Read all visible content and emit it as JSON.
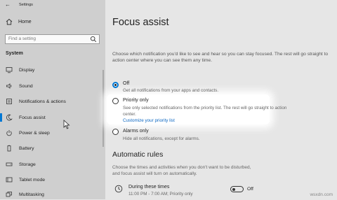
{
  "window": {
    "title": "Settings"
  },
  "sidebar": {
    "home_label": "Home",
    "search_placeholder": "Find a setting",
    "section_heading": "System",
    "items": [
      {
        "label": "Display",
        "icon": "monitor-icon"
      },
      {
        "label": "Sound",
        "icon": "speaker-icon"
      },
      {
        "label": "Notifications & actions",
        "icon": "notification-icon"
      },
      {
        "label": "Focus assist",
        "icon": "moon-icon",
        "selected": true
      },
      {
        "label": "Power & sleep",
        "icon": "power-icon"
      },
      {
        "label": "Battery",
        "icon": "battery-icon"
      },
      {
        "label": "Storage",
        "icon": "storage-icon"
      },
      {
        "label": "Tablet mode",
        "icon": "tablet-icon"
      },
      {
        "label": "Multitasking",
        "icon": "multitasking-icon"
      }
    ]
  },
  "main": {
    "title": "Focus assist",
    "description": "Choose which notification you'd like to see and hear so you can stay focused. The rest will go straight to action center where you can see them any time.",
    "options": [
      {
        "label": "Off",
        "sub": "Get all notifications from your apps and contacts.",
        "selected": true
      },
      {
        "label": "Priority only",
        "sub": "See only selected notifications from the priority list. The rest will go straight to action center.",
        "link": "Customize your priority list",
        "selected": false
      },
      {
        "label": "Alarms only",
        "sub": "Hide all notifications, except for alarms.",
        "selected": false
      }
    ],
    "rules_heading": "Automatic rules",
    "rules_description": "Choose the times and activities when you don't want to be disturbed, and focus assist will turn on automatically.",
    "rule": {
      "label": "During these times",
      "sub": "11:00 PM - 7:00 AM; Priority only",
      "toggle_label": "Off",
      "toggle_on": false
    }
  },
  "watermark": "wsxdn.com",
  "colors": {
    "accent": "#0078d4",
    "link": "#0a66c2"
  }
}
